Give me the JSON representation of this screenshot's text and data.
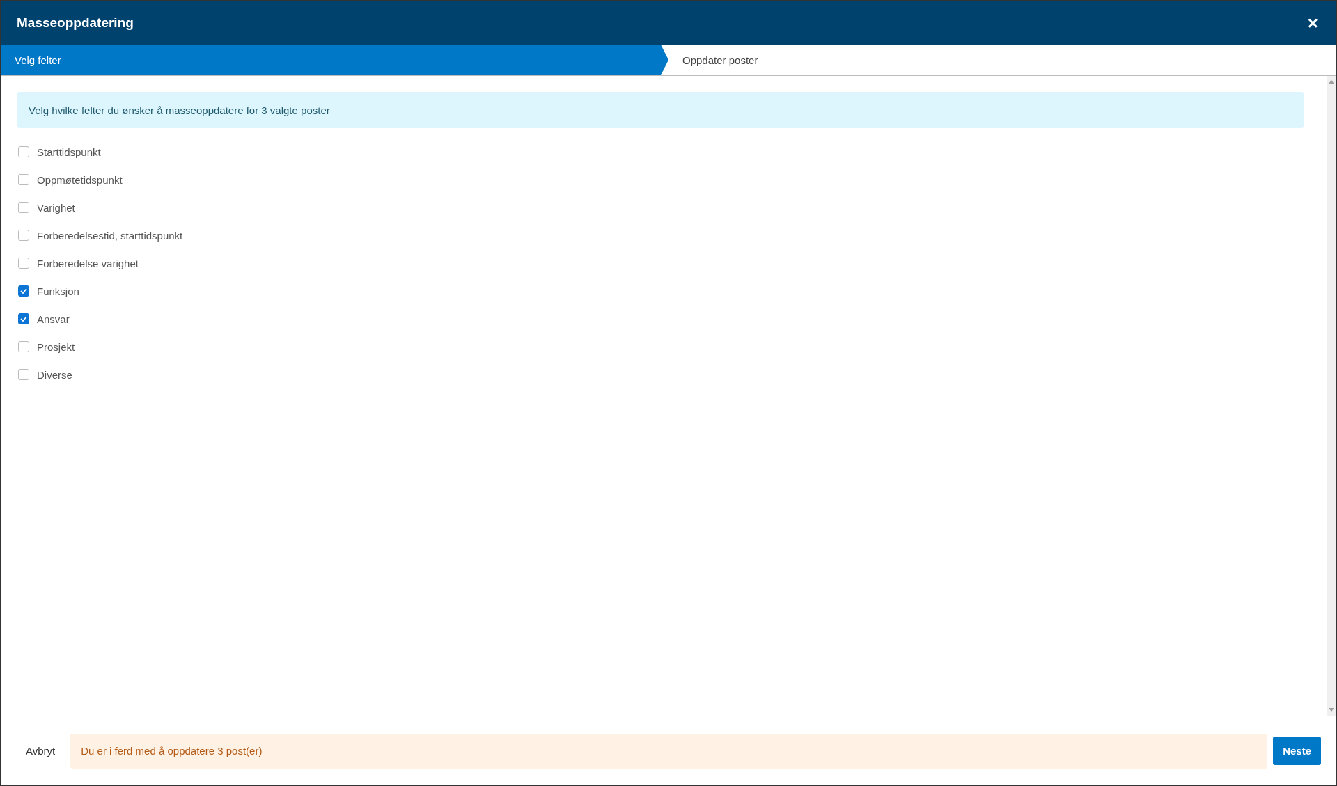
{
  "window": {
    "title": "Masseoppdatering",
    "close": "×"
  },
  "steps": [
    {
      "label": "Velg felter",
      "selected": true
    },
    {
      "label": "Oppdater poster",
      "selected": false
    }
  ],
  "info": "Velg hvilke felter du ønsker å masseoppdatere for 3 valgte poster",
  "fields": [
    {
      "label": "Starttidspunkt",
      "checked": false
    },
    {
      "label": "Oppmøtetidspunkt",
      "checked": false
    },
    {
      "label": "Varighet",
      "checked": false
    },
    {
      "label": "Forberedelsestid, starttidspunkt",
      "checked": false
    },
    {
      "label": "Forberedelse varighet",
      "checked": false
    },
    {
      "label": "Funksjon",
      "checked": true
    },
    {
      "label": "Ansvar",
      "checked": true
    },
    {
      "label": "Prosjekt",
      "checked": false
    },
    {
      "label": "Diverse",
      "checked": false
    }
  ],
  "footer": {
    "cancel": "Avbryt",
    "warning": "Du er i ferd med å oppdatere 3 post(er)",
    "next": "Neste"
  }
}
